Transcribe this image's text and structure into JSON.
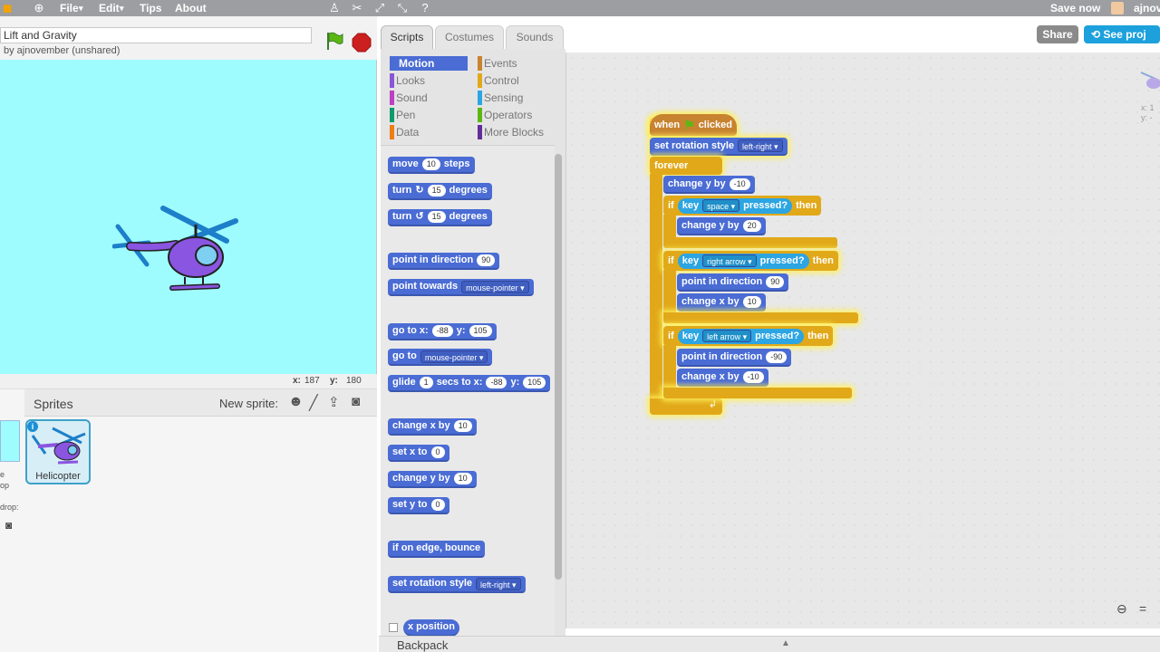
{
  "menu": {
    "file": "File",
    "edit": "Edit",
    "tips": "Tips",
    "about": "About",
    "save_now": "Save now",
    "user": "ajnov"
  },
  "project": {
    "title": "Lift and Gravity",
    "byline": "by ajnovember (unshared)"
  },
  "stage": {
    "x_label": "x:",
    "x_value": "187",
    "y_label": "y:",
    "y_value": "180"
  },
  "sprites": {
    "header": "Sprites",
    "new_sprite": "New sprite:",
    "sprite_name": "Helicopter",
    "stage_side_1": "e",
    "stage_side_2": "op",
    "stage_side_3": "drop:"
  },
  "tabs": [
    "Scripts",
    "Costumes",
    "Sounds"
  ],
  "categories": {
    "left": [
      "Motion",
      "Looks",
      "Sound",
      "Pen",
      "Data"
    ],
    "right": [
      "Events",
      "Control",
      "Sensing",
      "Operators",
      "More Blocks"
    ],
    "left_colors": [
      "#4a6cd4",
      "#8a55d7",
      "#bb42c3",
      "#0e9a6c",
      "#ee7d16"
    ],
    "right_colors": [
      "#c88330",
      "#e1a91a",
      "#2ca5e2",
      "#5cb712",
      "#632d99"
    ]
  },
  "palette": {
    "move": "move",
    "move_n": "10",
    "steps": "steps",
    "turn": "turn",
    "turn_cw": "↻",
    "turn_ccw": "↺",
    "turn_n": "15",
    "degrees": "degrees",
    "point_dir": "point in direction",
    "dir_val": "90",
    "point_towards": "point towards",
    "mouse_pointer": "mouse-pointer",
    "goto_xy": "go to x:",
    "gx": "-88",
    "y_lbl": "y:",
    "gy": "105",
    "goto": "go to",
    "glide": "glide",
    "glide_n": "1",
    "secs_to_x": "secs to x:",
    "change_x": "change x by",
    "cx": "10",
    "set_x": "set x to",
    "sx": "0",
    "change_y": "change y by",
    "cy": "10",
    "set_y": "set y to",
    "sy": "0",
    "bounce": "if on edge, bounce",
    "set_rot": "set rotation style",
    "rot_val": "left-right",
    "x_position": "x position"
  },
  "script": {
    "when": "when",
    "clicked": "clicked",
    "set_rot": "set rotation style",
    "rot_val": "left-right",
    "forever": "forever",
    "change_y": "change y by",
    "v_neg10": "-10",
    "if": "if",
    "key": "key",
    "pressed": "pressed?",
    "then": "then",
    "space": "space",
    "v20": "20",
    "right_arrow": "right arrow",
    "point_dir": "point in direction",
    "v90": "90",
    "change_x": "change x by",
    "v10": "10",
    "left_arrow": "left arrow",
    "v_neg90": "-90"
  },
  "header_buttons": {
    "share": "Share",
    "see_project": "See proj"
  },
  "backpack": "Backpack",
  "accent_colors": {
    "motion": "#4a6cd4",
    "control": "#e1a91a",
    "events": "#c88330",
    "sensing": "#2ca5e2",
    "stage_bg": "#9ffcfe",
    "share_btn": "#7a7a7a",
    "see_btn": "#1ca1dc"
  }
}
